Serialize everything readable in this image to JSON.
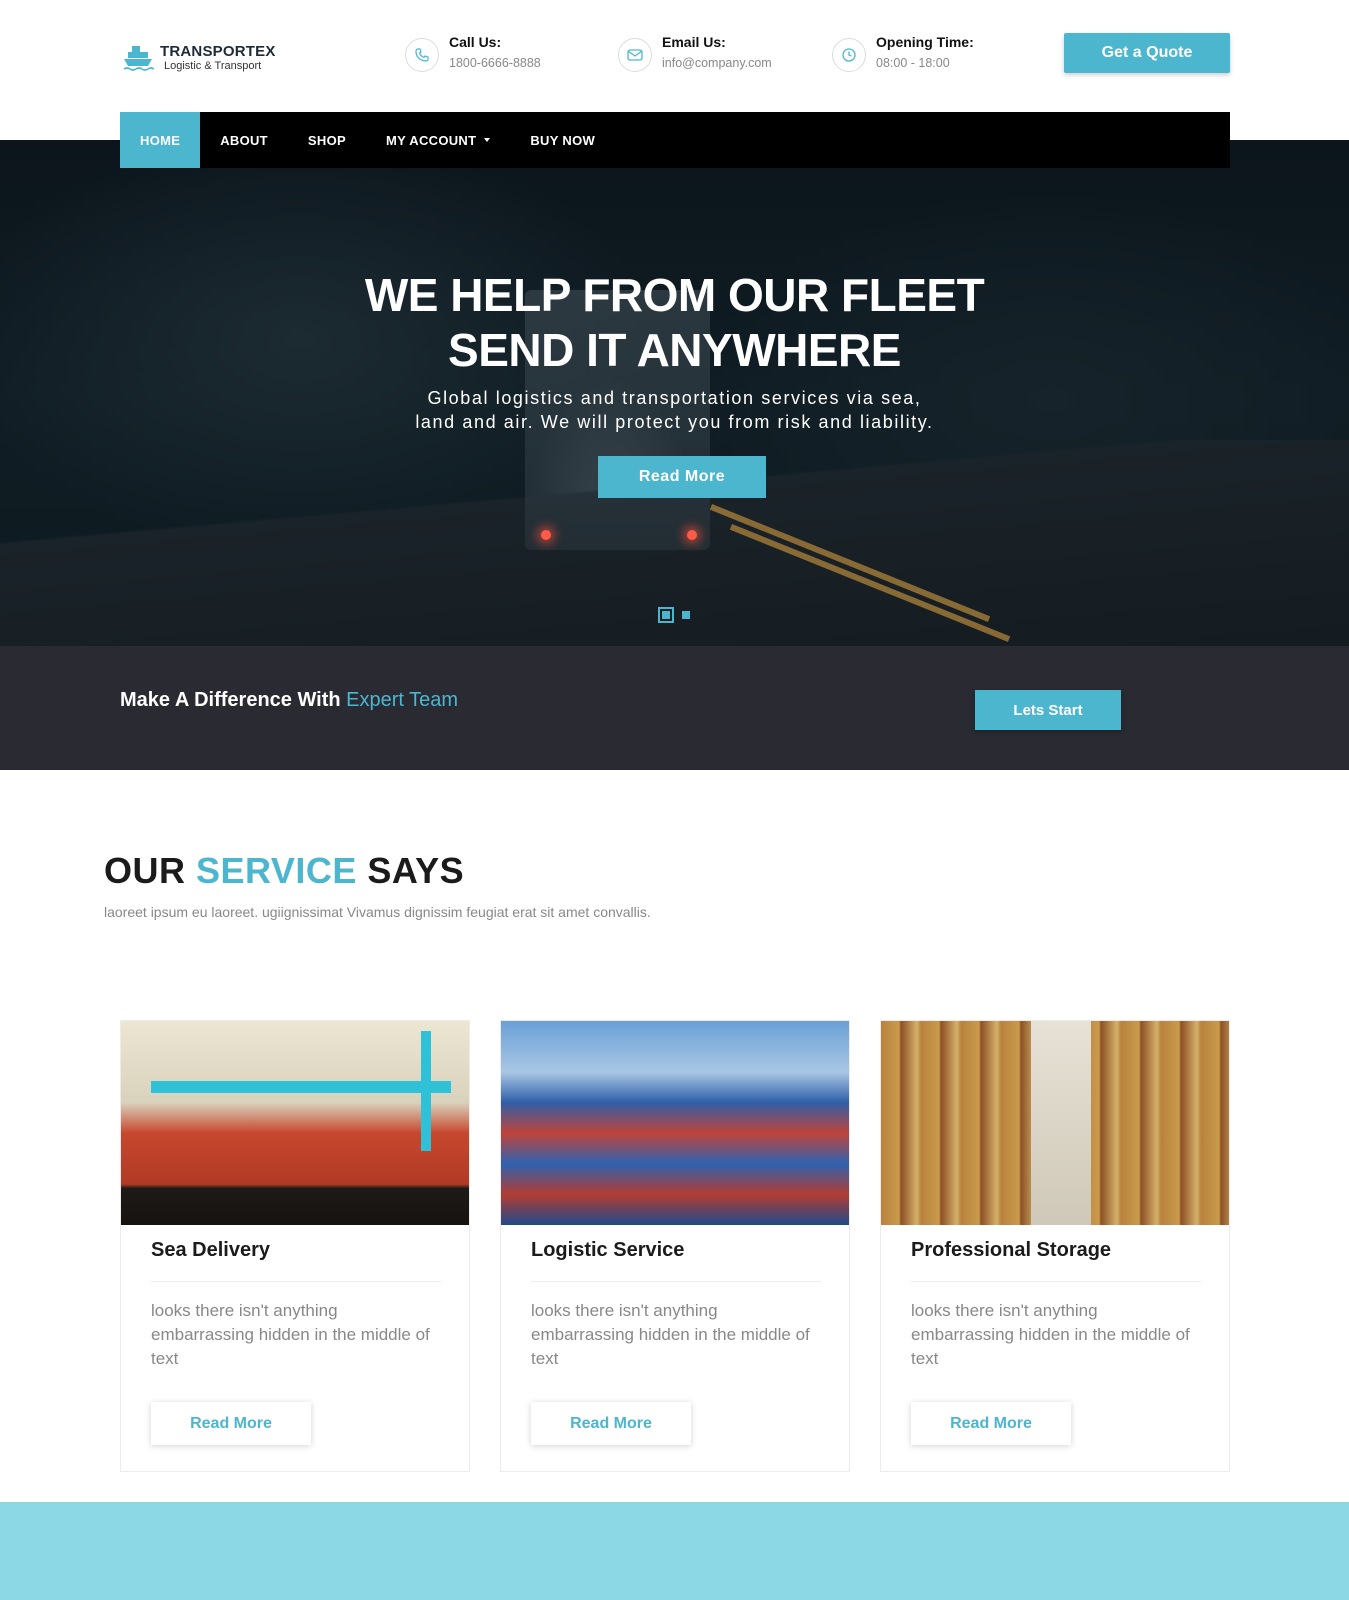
{
  "brand": {
    "name": "TRANSPORTEX",
    "tagline": "Logistic & Transport"
  },
  "contacts": [
    {
      "title": "Call Us:",
      "value": "1800-6666-8888",
      "icon": "phone-icon"
    },
    {
      "title": "Email Us:",
      "value": "info@company.com",
      "icon": "envelope-icon"
    },
    {
      "title": "Opening Time:",
      "value": "08:00 - 18:00",
      "icon": "clock-icon"
    }
  ],
  "header": {
    "quote_label": "Get a Quote"
  },
  "nav": {
    "items": [
      "HOME",
      "ABOUT",
      "SHOP",
      "MY ACCOUNT",
      "BUY NOW"
    ],
    "active": "HOME"
  },
  "hero": {
    "title_line1": "WE HELP FROM OUR FLEET",
    "title_line2": "SEND IT ANYWHERE",
    "subtitle_line1": "Global logistics and transportation services via sea,",
    "subtitle_line2": "land and air. We will protect you from risk and liability.",
    "button": "Read More",
    "slides": 2,
    "active_slide": 1
  },
  "band": {
    "text_prefix": "Make A Difference With ",
    "text_highlight": "Expert Team",
    "button": "Lets Start"
  },
  "services": {
    "title_prefix": "OUR ",
    "title_highlight": "SERVICE",
    "title_suffix": " SAYS",
    "subtitle": "laoreet ipsum eu laoreet. ugiignissimat Vivamus dignissim feugiat erat sit amet convallis.",
    "cards": [
      {
        "title": "Sea Delivery",
        "text": "looks there isn't anything embarrassing hidden in the middle of text",
        "button": "Read More"
      },
      {
        "title": "Logistic Service",
        "text": "looks there isn't anything embarrassing hidden in the middle of text",
        "button": "Read More"
      },
      {
        "title": "Professional Storage",
        "text": "looks there isn't anything embarrassing hidden in the middle of text",
        "button": "Read More"
      }
    ]
  },
  "colors": {
    "accent": "#4db6cf",
    "dark_band": "#2a2a33",
    "nav_bg": "#000000",
    "bottom_band": "#8dd8e5"
  }
}
